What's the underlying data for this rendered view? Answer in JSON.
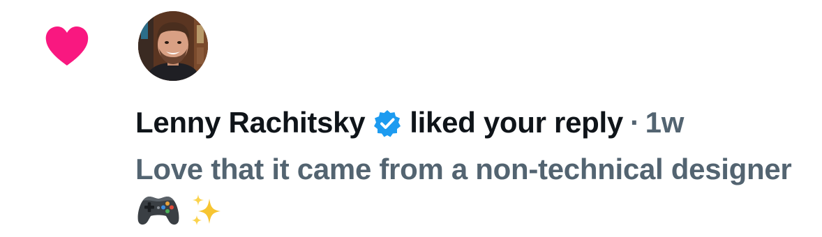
{
  "notification": {
    "user_name": "Lenny Rachitsky",
    "action": "liked your reply",
    "separator": "·",
    "time": "1w",
    "reply_text": "Love that it came from a non-technical designer",
    "reply_emojis": [
      "video-game-controller-emoji",
      "sparkles-emoji"
    ]
  },
  "colors": {
    "heart": "#f91880",
    "verified": "#1d9bf0",
    "primary_text": "#0f1419",
    "secondary_text": "#536471"
  }
}
